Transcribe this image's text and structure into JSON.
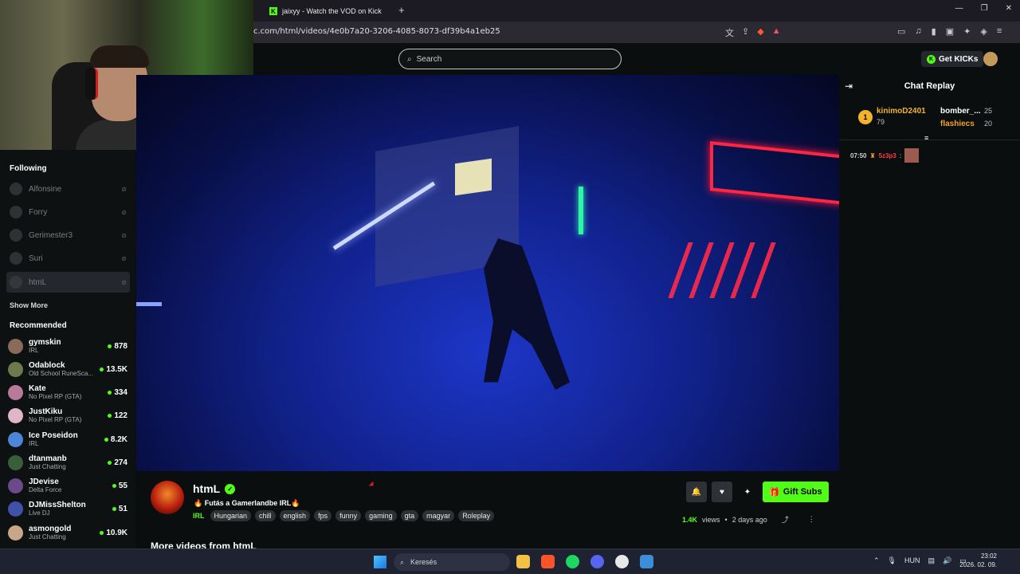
{
  "browser": {
    "tab_title": "jaixyy - Watch the VOD on Kick",
    "new_tab": "+",
    "url": "c.com/html/videos/4e0b7a20-3206-4085-8073-df39b4a1eb25",
    "window_controls": [
      "—",
      "❐",
      "✕"
    ]
  },
  "topnav": {
    "search_placeholder": "Search",
    "get_kicks_label": "Get KICKs"
  },
  "sidebar": {
    "following_title": "Following",
    "following": [
      {
        "name": "Alfonsine"
      },
      {
        "name": "Forry"
      },
      {
        "name": "Gerimester3"
      },
      {
        "name": "Suri"
      },
      {
        "name": "htmL"
      }
    ],
    "show_more": "Show More",
    "recommended_title": "Recommended",
    "recommended": [
      {
        "name": "gymskin",
        "category": "IRL",
        "viewers": "878",
        "color": "#8a6b5a"
      },
      {
        "name": "Odablock",
        "category": "Old School RuneSca...",
        "viewers": "13.5K",
        "color": "#6d7a4c"
      },
      {
        "name": "Kate",
        "category": "No Pixel RP (GTA)",
        "viewers": "334",
        "color": "#b77a9b"
      },
      {
        "name": "JustKiku",
        "category": "No Pixel RP (GTA)",
        "viewers": "122",
        "color": "#e0b6c7"
      },
      {
        "name": "Ice Poseidon",
        "category": "IRL",
        "viewers": "8.2K",
        "color": "#4d86d9"
      },
      {
        "name": "dtanmanb",
        "category": "Just Chatting",
        "viewers": "274",
        "color": "#3a5d3a"
      },
      {
        "name": "JDevise",
        "category": "Delta Force",
        "viewers": "55",
        "color": "#6a4a8a"
      },
      {
        "name": "DJMissShelton",
        "category": "Live DJ",
        "viewers": "51",
        "color": "#3f52a8"
      },
      {
        "name": "asmongold",
        "category": "Just Chatting",
        "viewers": "10.9K",
        "color": "#c9a58a"
      }
    ]
  },
  "chat": {
    "title": "Chat Replay",
    "leaderboard": {
      "rank": "1",
      "first_name": "kinimoD2401",
      "first_value": "79",
      "second_name": "bomber_...",
      "second_value": "25",
      "third_name": "flashiecs",
      "third_value": "20"
    },
    "messages": [
      {
        "time": "07:50",
        "user": "5z3p3",
        "separator": ":"
      }
    ]
  },
  "stream": {
    "streamer_name": "htmL",
    "vod_title": "🔥 Futás a Gamerlandbe IRL🔥",
    "category": "IRL",
    "tags": [
      "Hungarian",
      "chill",
      "english",
      "fps",
      "funny",
      "gaming",
      "gta",
      "magyar",
      "Roleplay"
    ],
    "gift_subs_label": "Gift Subs",
    "views_value": "1.4K",
    "views_label": "views",
    "separator": "•",
    "date": "2 days ago",
    "more_videos": "More videos from htmL"
  },
  "taskbar": {
    "search_label": "Keresés",
    "lang": "HUN",
    "time": "23:02",
    "date": "2026. 02. 09."
  },
  "colors": {
    "accent": "#53fc18",
    "background": "#0b0e0f"
  }
}
